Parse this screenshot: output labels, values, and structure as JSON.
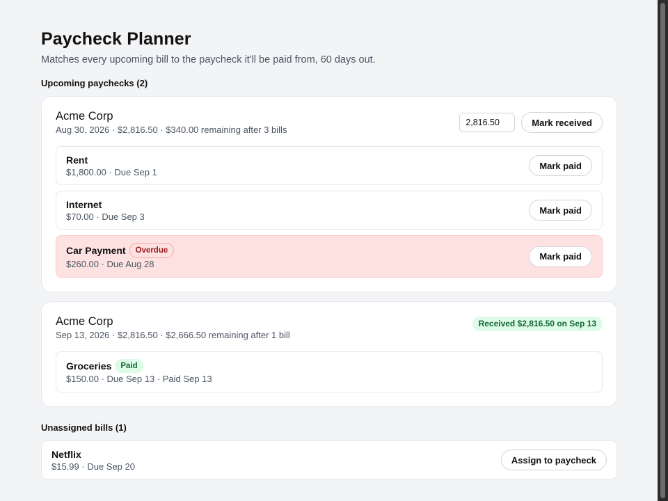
{
  "header": {
    "title": "Paycheck Planner",
    "subtitle": "Matches every upcoming bill to the paycheck it'll be paid from, 60 days out."
  },
  "upcoming": {
    "heading": "Upcoming paychecks (2)",
    "paychecks": [
      {
        "employer": "Acme Corp",
        "meta": "Aug 30, 2026 · $2,816.50 · $340.00 remaining after 3 bills",
        "amount_value": "2,816.50",
        "mark_received_label": "Mark received",
        "bills": [
          {
            "name": "Rent",
            "meta": "$1,800.00 · Due Sep 1",
            "action": "Mark paid"
          },
          {
            "name": "Internet",
            "meta": "$70.00 · Due Sep 3",
            "action": "Mark paid"
          },
          {
            "name": "Car Payment",
            "badge": "Overdue",
            "meta": "$260.00 · Due Aug 28",
            "action": "Mark paid"
          }
        ]
      },
      {
        "employer": "Acme Corp",
        "meta": "Sep 13, 2026 · $2,816.50 · $2,666.50 remaining after 1 bill",
        "received_badge": "Received $2,816.50 on Sep 13",
        "bills": [
          {
            "name": "Groceries",
            "badge": "Paid",
            "meta": "$150.00 · Due Sep 13 · Paid Sep 13"
          }
        ]
      }
    ]
  },
  "unassigned": {
    "heading": "Unassigned bills (1)",
    "bills": [
      {
        "name": "Netflix",
        "meta": "$15.99 · Due Sep 20",
        "action": "Assign to paycheck"
      }
    ]
  },
  "colors": {
    "background": "#f3f4f6",
    "overdue_bg": "#fee2e2",
    "paid_badge_bg": "#dcfce7",
    "paid_badge_text": "#166534"
  }
}
